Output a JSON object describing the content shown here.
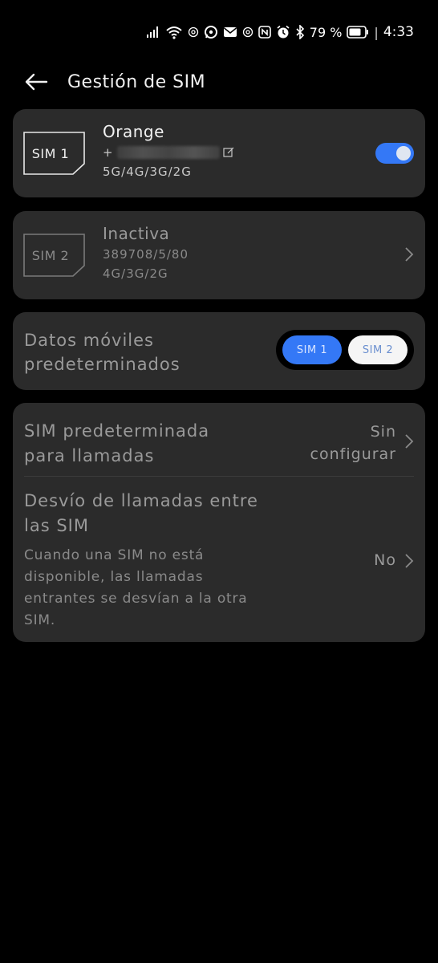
{
  "status_bar": {
    "battery_percent": "79 %",
    "separator": "|",
    "time": "4:33",
    "icons": [
      "signal-icon",
      "wifi-icon",
      "at-icon",
      "whatsapp-icon",
      "mail-icon",
      "at-icon",
      "nfc-icon",
      "alarm-icon",
      "bluetooth-icon",
      "battery-icon"
    ]
  },
  "header": {
    "title": "Gestión de SIM"
  },
  "sim1": {
    "chip_label": "SIM 1",
    "name": "Orange",
    "phone_prefix": "+",
    "network": "5G/4G/3G/2G",
    "enabled": true
  },
  "sim2": {
    "chip_label": "SIM 2",
    "status": "Inactiva",
    "number": "389708/5/80",
    "network": "4G/3G/2G"
  },
  "default_data": {
    "label_line1": "Datos móviles",
    "label_line2": "predeterminados",
    "option1": "SIM 1",
    "option2": "SIM 2",
    "selected": "SIM 1"
  },
  "calls": {
    "default_sim": {
      "title_line1": "SIM predeterminada",
      "title_line2": "para llamadas",
      "value_line1": "Sin",
      "value_line2": "configurar"
    },
    "forwarding": {
      "title_line1": "Desvío de llamadas entre",
      "title_line2": "las SIM",
      "desc_line1": "Cuando una SIM no está",
      "desc_line2": "disponible, las llamadas",
      "desc_line3": "entrantes se desvían a la otra",
      "desc_line4": "SIM.",
      "value": "No"
    }
  },
  "colors": {
    "background": "#000000",
    "card": "#2b2b2b",
    "accent": "#3478f6"
  }
}
